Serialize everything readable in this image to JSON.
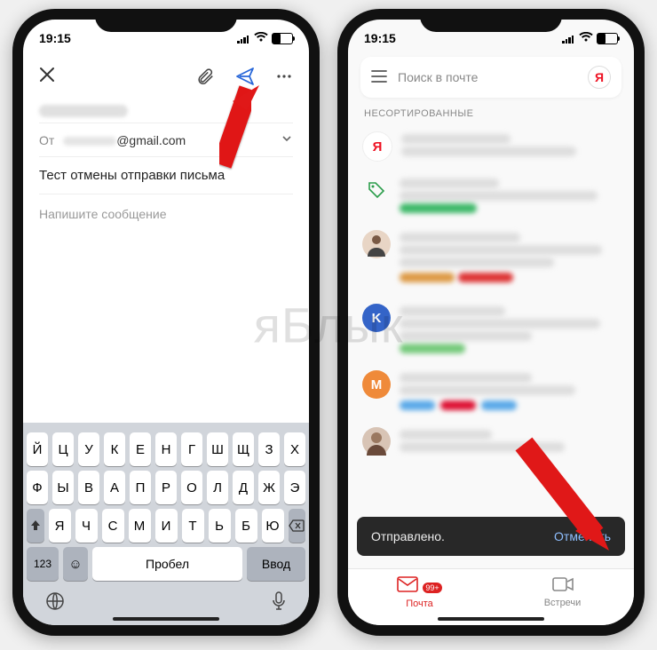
{
  "watermark": "яБлык",
  "status": {
    "time": "19:15"
  },
  "compose": {
    "from_label": "От",
    "from_email_suffix": "@gmail.com",
    "subject": "Тест отмены отправки письма",
    "body_placeholder": "Напишите сообщение"
  },
  "keyboard": {
    "row1": [
      "Й",
      "Ц",
      "У",
      "К",
      "Е",
      "Н",
      "Г",
      "Ш",
      "Щ",
      "З",
      "Х"
    ],
    "row2": [
      "Ф",
      "Ы",
      "В",
      "А",
      "П",
      "Р",
      "О",
      "Л",
      "Д",
      "Ж",
      "Э"
    ],
    "row3": [
      "Я",
      "Ч",
      "С",
      "М",
      "И",
      "Т",
      "Ь",
      "Б",
      "Ю"
    ],
    "numbers": "123",
    "space": "Пробел",
    "enter": "Ввод"
  },
  "inbox": {
    "search_placeholder": "Поиск в почте",
    "yandex_letter": "Я",
    "section_label": "НЕСОРТИРОВАННЫЕ",
    "toast_message": "Отправлено.",
    "toast_undo": "Отменить",
    "nav_mail": "Почта",
    "nav_meet": "Встречи",
    "nav_badge": "99+"
  }
}
